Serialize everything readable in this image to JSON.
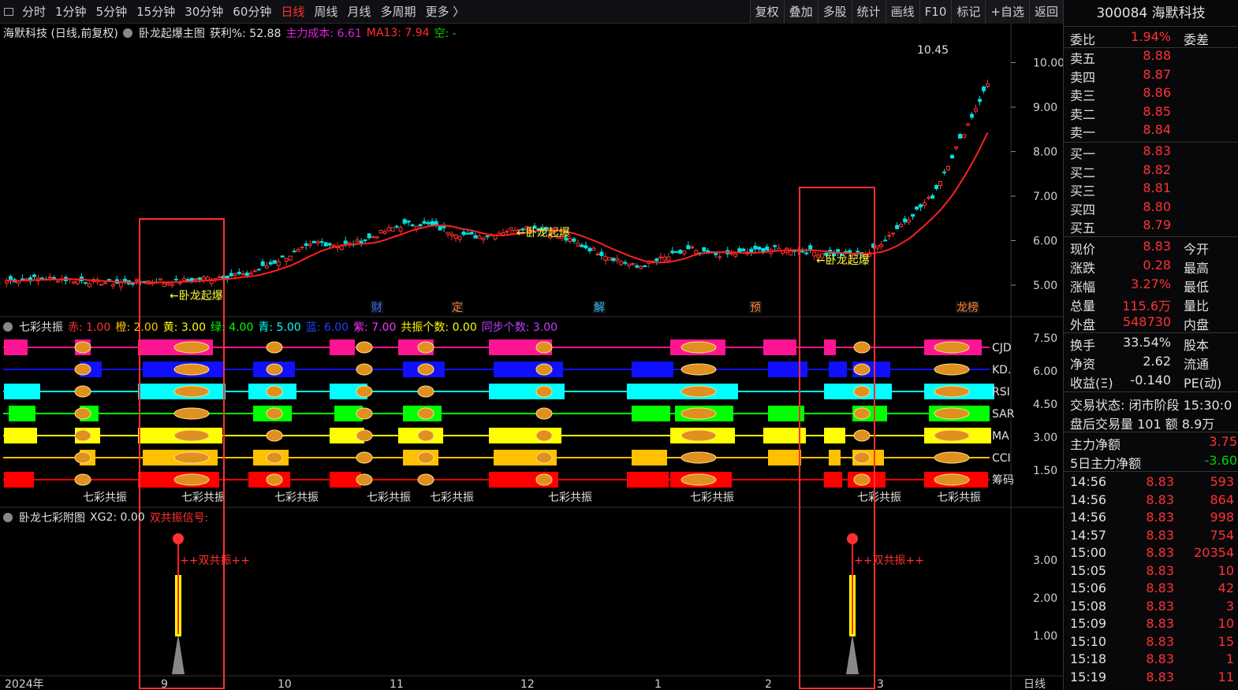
{
  "toolbar": {
    "left": [
      "分时",
      "1分钟",
      "5分钟",
      "15分钟",
      "30分钟",
      "60分钟",
      "日线",
      "周线",
      "月线",
      "多周期",
      "更多 〉"
    ],
    "active": "日线",
    "right": [
      "复权",
      "叠加",
      "多股",
      "统计",
      "画线",
      "F10",
      "标记",
      "+自选",
      "返回"
    ]
  },
  "main_legend": {
    "stock": "海默科技 (日线,前复权)",
    "indicator": "卧龙起爆主图",
    "profit_label": "获利%: 52.88",
    "cost": "主力成本: 6.61",
    "ma13": "MA13: 7.94",
    "kong": "空: -"
  },
  "price_axis": [
    "10.00",
    "9.00",
    "8.00",
    "7.00",
    "6.00",
    "5.00"
  ],
  "high_label": "10.45",
  "signal_text": "←卧龙起爆",
  "markers": [
    "财",
    "定",
    "解",
    "预",
    "龙榜"
  ],
  "qicai_legend": {
    "name": "七彩共振",
    "items": [
      "赤: 1.00",
      "橙: 2.00",
      "黄: 3.00",
      "绿: 4.00",
      "青: 5.00",
      "蓝: 6.00",
      "紫: 7.00",
      "共振个数: 0.00",
      "同步个数: 3.00"
    ]
  },
  "qicai_rows": [
    "CJD",
    "KD.",
    "RSI",
    "SAR",
    "MA",
    "CCI",
    "筹码"
  ],
  "qicai_axis": [
    "7.50",
    "6.00",
    "4.50",
    "3.00",
    "1.50"
  ],
  "qicai_label": "七彩共振",
  "sub_legend": {
    "name": "卧龙七彩附图",
    "xg": "XG2: 0.00",
    "sig": "双共振信号:"
  },
  "sub_signal": "++双共振++",
  "sub_axis": [
    "3.00",
    "2.00",
    "1.00"
  ],
  "time_axis": [
    "2024年",
    "9",
    "10",
    "11",
    "12",
    "1",
    "2",
    "3"
  ],
  "period_label": "日线",
  "panel": {
    "title": "300084 海默科技",
    "weibi": {
      "label": "委比",
      "value": "1.94%",
      "label2": "委差"
    },
    "sells": [
      {
        "l": "卖五",
        "v": "8.88"
      },
      {
        "l": "卖四",
        "v": "8.87"
      },
      {
        "l": "卖三",
        "v": "8.86"
      },
      {
        "l": "卖二",
        "v": "8.85"
      },
      {
        "l": "卖一",
        "v": "8.84"
      }
    ],
    "buys": [
      {
        "l": "买一",
        "v": "8.83"
      },
      {
        "l": "买二",
        "v": "8.82"
      },
      {
        "l": "买三",
        "v": "8.81"
      },
      {
        "l": "买四",
        "v": "8.80"
      },
      {
        "l": "买五",
        "v": "8.79"
      }
    ],
    "quote": [
      {
        "l": "现价",
        "v": "8.83",
        "l2": "今开"
      },
      {
        "l": "涨跌",
        "v": "0.28",
        "l2": "最高"
      },
      {
        "l": "涨幅",
        "v": "3.27%",
        "l2": "最低"
      },
      {
        "l": "总量",
        "v": "115.6万",
        "l2": "量比"
      },
      {
        "l": "外盘",
        "v": "548730",
        "l2": "内盘"
      }
    ],
    "stats": [
      {
        "l": "换手",
        "v": "33.54%",
        "l2": "股本"
      },
      {
        "l": "净资",
        "v": "2.62",
        "l2": "流通"
      },
      {
        "l": "收益(Ξ)",
        "v": "-0.140",
        "l2": "PE(动)"
      }
    ],
    "status": "交易状态: 闭市阶段 15:30:0",
    "after": "盘后交易量 101 额 8.9万",
    "flow": [
      {
        "l": "主力净额",
        "v": "3.75"
      },
      {
        "l": "5日主力净额",
        "v": "-3.60"
      }
    ],
    "ticks": [
      {
        "t": "14:56",
        "p": "8.83",
        "v": "593"
      },
      {
        "t": "14:56",
        "p": "8.83",
        "v": "864"
      },
      {
        "t": "14:56",
        "p": "8.83",
        "v": "998"
      },
      {
        "t": "14:57",
        "p": "8.83",
        "v": "754"
      },
      {
        "t": "15:00",
        "p": "8.83",
        "v": "20354"
      },
      {
        "t": "15:05",
        "p": "8.83",
        "v": "10"
      },
      {
        "t": "15:06",
        "p": "8.83",
        "v": "42"
      },
      {
        "t": "15:08",
        "p": "8.83",
        "v": "3"
      },
      {
        "t": "15:09",
        "p": "8.83",
        "v": "10"
      },
      {
        "t": "15:10",
        "p": "8.83",
        "v": "15"
      },
      {
        "t": "15:18",
        "p": "8.83",
        "v": "1"
      },
      {
        "t": "15:19",
        "p": "8.83",
        "v": "11"
      }
    ]
  }
}
